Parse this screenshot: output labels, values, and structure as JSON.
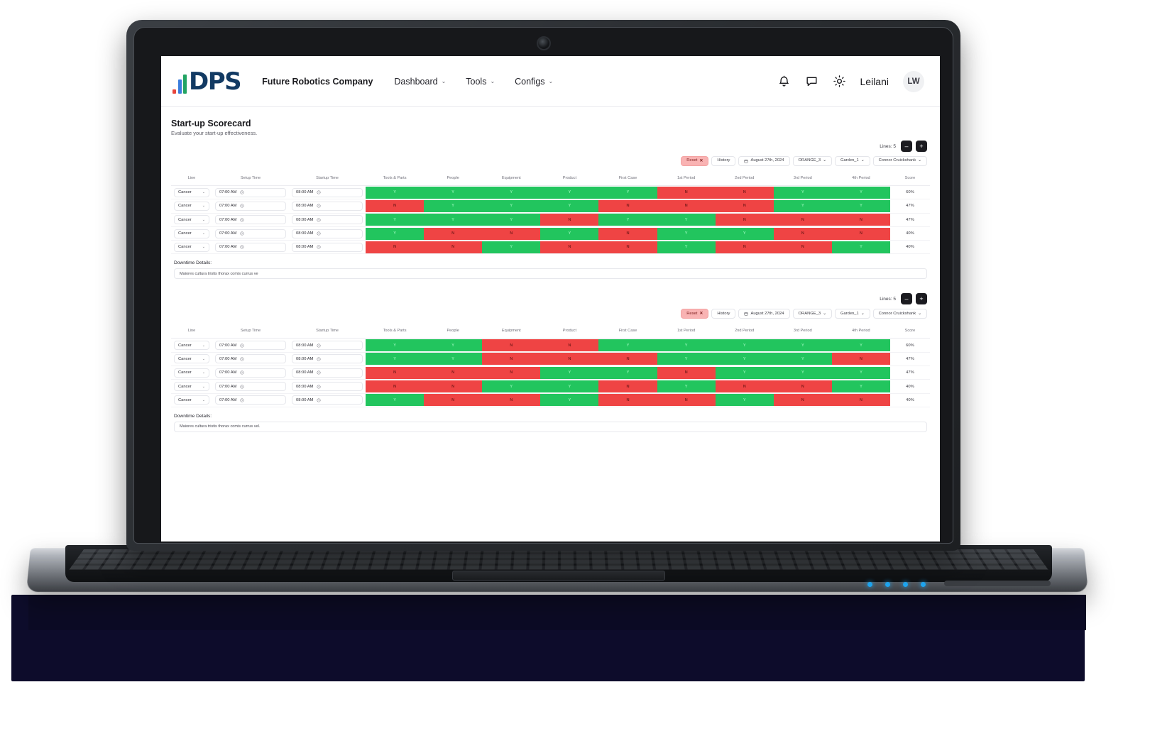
{
  "navbar": {
    "logo_text": "DPS",
    "company": "Future Robotics Company",
    "links": [
      {
        "label": "Dashboard",
        "caret": "⌄"
      },
      {
        "label": "Tools",
        "caret": "⌄"
      },
      {
        "label": "Configs",
        "caret": "⌄"
      }
    ],
    "icons": [
      "bell-icon",
      "chat-icon",
      "brightness-icon"
    ],
    "user_name": "Leilani",
    "avatar_initials": "LW"
  },
  "page": {
    "title": "Start-up Scorecard",
    "subtitle": "Evaluate your start-up effectiveness."
  },
  "controls": {
    "lines_label": "Lines: 5",
    "minus": "–",
    "plus": "+"
  },
  "filters": [
    {
      "label": "Reset",
      "x": "✕",
      "kind": "reset"
    },
    {
      "label": "History",
      "kind": "plain"
    },
    {
      "label": "August 27th, 2024",
      "kind": "date"
    },
    {
      "label": "ORANGE_3",
      "caret": "⌄",
      "kind": "select"
    },
    {
      "label": "Garden_1",
      "caret": "⌄",
      "kind": "select"
    },
    {
      "label": "Connor Cruickshank",
      "caret": "⌄",
      "kind": "select"
    }
  ],
  "table": {
    "headers": [
      "Line",
      "Setup Time",
      "Startup Time",
      "Tools & Parts",
      "People",
      "Equipment",
      "Product",
      "First Case",
      "1st Period",
      "2nd Period",
      "3rd Period",
      "4th Period",
      "Score"
    ],
    "status_columns": [
      "Tools & Parts",
      "People",
      "Equipment",
      "Product",
      "First Case",
      "1st Period",
      "2nd Period",
      "3rd Period",
      "4th Period"
    ],
    "line_value": "Cancer",
    "setup_time": "07:00 AM",
    "startup_time": "08:00 AM",
    "yes_glyph": "Y",
    "no_glyph": "N"
  },
  "colors": {
    "green": "#22c55e",
    "red": "#ef4444",
    "reset_chip": "#f9b3b3",
    "logo_navy": "#123a63"
  },
  "downtime": {
    "title": "Downtime Details:",
    "text_1": "Maiores cultura tristis thorax comis currus ve",
    "text_2": "Maiores cultura tristis thorax comis currus vel."
  },
  "scorecards": [
    {
      "id": "scorecard-1",
      "rows": [
        {
          "statuses": [
            "Y",
            "Y",
            "Y",
            "Y",
            "Y",
            "N",
            "N",
            "Y",
            "Y"
          ],
          "score": "60%"
        },
        {
          "statuses": [
            "N",
            "Y",
            "Y",
            "Y",
            "N",
            "N",
            "N",
            "Y",
            "Y"
          ],
          "score": "47%"
        },
        {
          "statuses": [
            "Y",
            "Y",
            "Y",
            "N",
            "Y",
            "Y",
            "N",
            "N",
            "N"
          ],
          "score": "47%"
        },
        {
          "statuses": [
            "Y",
            "N",
            "N",
            "Y",
            "N",
            "Y",
            "Y",
            "N",
            "N"
          ],
          "score": "40%"
        },
        {
          "statuses": [
            "N",
            "N",
            "Y",
            "N",
            "N",
            "Y",
            "N",
            "N",
            "Y"
          ],
          "score": "40%"
        }
      ]
    },
    {
      "id": "scorecard-2",
      "rows": [
        {
          "statuses": [
            "Y",
            "Y",
            "N",
            "N",
            "Y",
            "Y",
            "Y",
            "Y",
            "Y"
          ],
          "score": "60%"
        },
        {
          "statuses": [
            "Y",
            "Y",
            "N",
            "N",
            "N",
            "Y",
            "Y",
            "Y",
            "N"
          ],
          "score": "47%"
        },
        {
          "statuses": [
            "N",
            "N",
            "N",
            "Y",
            "Y",
            "N",
            "Y",
            "Y",
            "Y"
          ],
          "score": "47%"
        },
        {
          "statuses": [
            "N",
            "N",
            "Y",
            "Y",
            "N",
            "Y",
            "N",
            "N",
            "Y"
          ],
          "score": "40%"
        },
        {
          "statuses": [
            "Y",
            "N",
            "N",
            "Y",
            "N",
            "N",
            "Y",
            "N",
            "N"
          ],
          "score": "40%"
        }
      ]
    }
  ]
}
